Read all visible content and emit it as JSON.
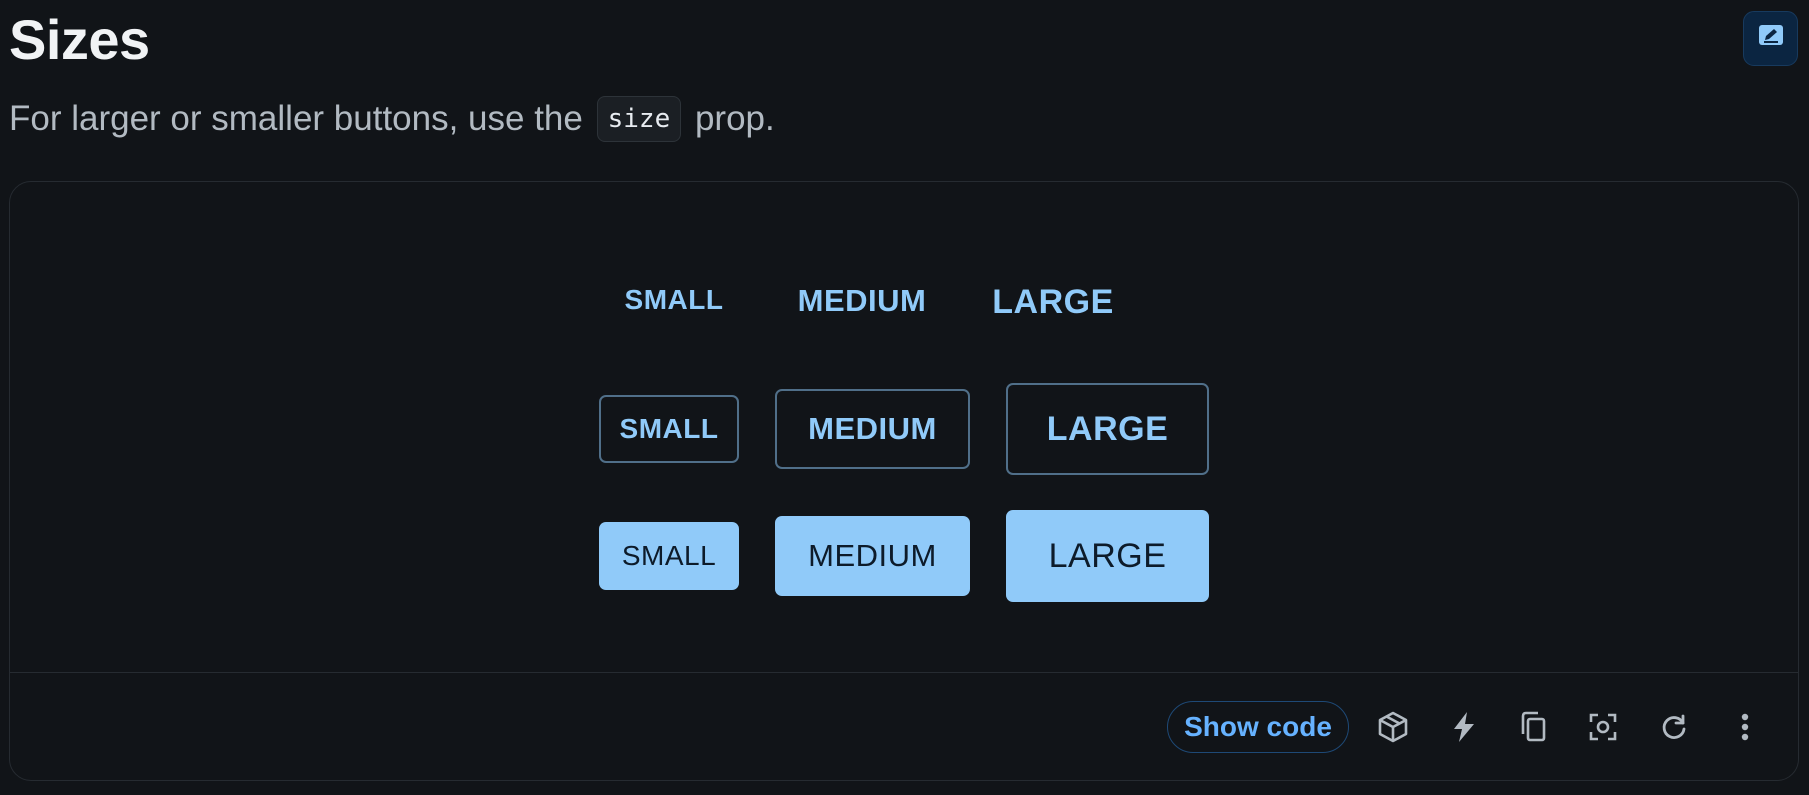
{
  "section": {
    "title": "Sizes",
    "description_before": "For larger or smaller buttons, use the",
    "code": "size",
    "description_after": "prop."
  },
  "demo": {
    "text_buttons": [
      "SMALL",
      "MEDIUM",
      "LARGE"
    ],
    "outlined_buttons": [
      "SMALL",
      "MEDIUM",
      "LARGE"
    ],
    "contained_buttons": [
      "SMALL",
      "MEDIUM",
      "LARGE"
    ]
  },
  "toolbar": {
    "show_code_label": "Show code",
    "icons": [
      "codesandbox-icon",
      "stackblitz-icon",
      "copy-icon",
      "reset-focus-icon",
      "reset-demo-icon",
      "more-vert-icon"
    ]
  },
  "colors": {
    "background": "#111418",
    "primary": "#90caf9",
    "link": "#66b2ff",
    "border": "#262b31"
  }
}
